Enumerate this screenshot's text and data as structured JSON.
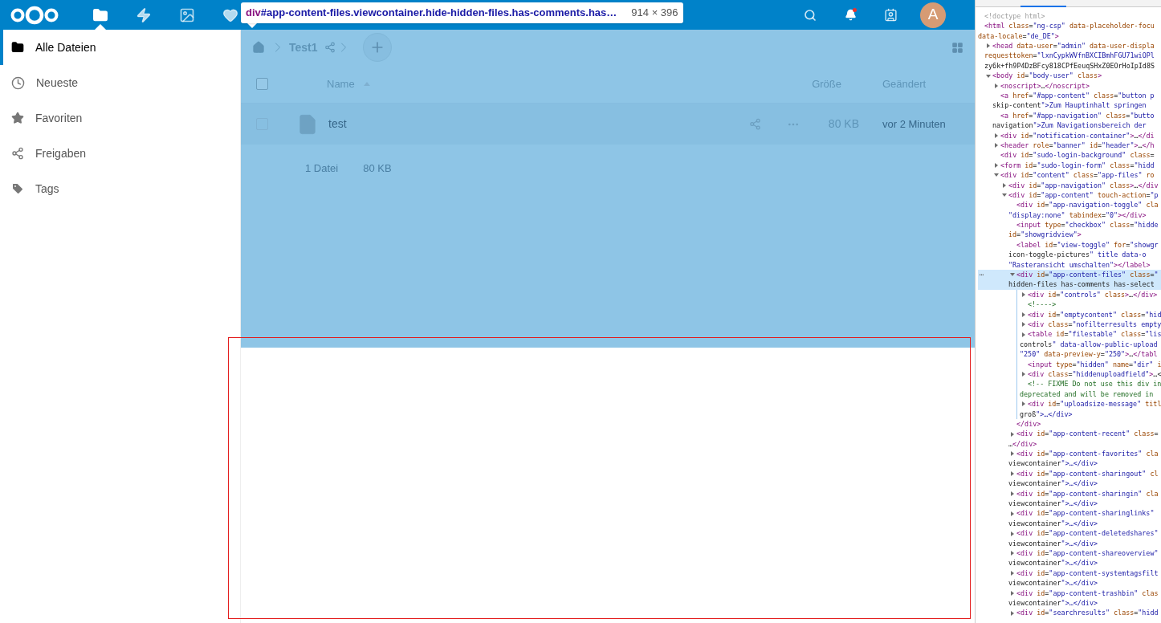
{
  "inspector_tooltip": {
    "tag": "div",
    "selector": "#app-content-files.viewcontainer.hide-hidden-files.has-comments.has…",
    "size": "914 × 396"
  },
  "header": {
    "apps": [
      {
        "kind": "files",
        "selected": true
      },
      {
        "kind": "activity",
        "selected": false
      },
      {
        "kind": "gallery",
        "selected": false
      },
      {
        "kind": "favorites",
        "selected": false
      }
    ],
    "actions": [
      {
        "kind": "search"
      },
      {
        "kind": "notifications",
        "unread": true
      },
      {
        "kind": "contacts"
      }
    ],
    "avatar": "A"
  },
  "sidebar": {
    "items": [
      {
        "label": "Alle Dateien",
        "kind": "folder",
        "selected": true
      },
      {
        "label": "Neueste",
        "kind": "clock",
        "selected": false
      },
      {
        "label": "Favoriten",
        "kind": "star",
        "selected": false
      },
      {
        "label": "Freigaben",
        "kind": "share",
        "selected": false
      },
      {
        "label": "Tags",
        "kind": "tag",
        "selected": false
      }
    ]
  },
  "files": {
    "highlighted": true,
    "breadcrumb": [
      "Test1"
    ],
    "columns": {
      "name": "Name",
      "size": "Größe",
      "modified": "Geändert"
    },
    "rows": [
      {
        "name": "test",
        "size": "80 KB",
        "modified": "vor 2 Minuten",
        "checked": false
      }
    ],
    "summary": {
      "count": "1 Datei",
      "size": "80 KB"
    }
  },
  "red_frame": true,
  "devtools": {
    "nodes": [
      {
        "kind": "doctype",
        "lines": [
          "<!doctype html>"
        ],
        "selected": false
      },
      {
        "kind": "element",
        "lines": [
          "<html class=\"ng-csp\" data-placeholder-focu",
          "data-locale=\"de_DE\">"
        ],
        "selected": false,
        "children": [
          {
            "kind": "element",
            "lines": [
              "<head data-user=\"admin\" data-user-displa",
              "requesttoken=\"lxnCypkWVfnBXCIBmhFGU71wiOPl",
              "zy6k+fh9P4DzBFcy818CPfEeuqSHxZ0EOrHoIpId8S"
            ],
            "expanded": false,
            "selected": false
          },
          {
            "kind": "element",
            "lines": [
              "<body id=\"body-user\" class>"
            ],
            "expanded": true,
            "selected": false,
            "children": [
              {
                "kind": "element",
                "lines": [
                  "<noscript>…</noscript>"
                ],
                "expanded": false,
                "selected": false
              },
              {
                "kind": "element",
                "lines": [
                  "<a href=\"#app-content\" class=\"button p",
                  "skip-content\">Zum Hauptinhalt springen"
                ],
                "selected": false
              },
              {
                "kind": "element",
                "lines": [
                  "<a href=\"#app-navigation\" class=\"butto",
                  "navigation\">Zum Navigationsbereich der"
                ],
                "selected": false
              },
              {
                "kind": "element",
                "lines": [
                  "<div id=\"notification-container\">…</di"
                ],
                "expanded": false,
                "selected": false
              },
              {
                "kind": "element",
                "lines": [
                  "<header role=\"banner\" id=\"header\">…</h"
                ],
                "expanded": false,
                "selected": false
              },
              {
                "kind": "element",
                "lines": [
                  "<div id=\"sudo-login-background\" class="
                ],
                "selected": false
              },
              {
                "kind": "element",
                "lines": [
                  "<form id=\"sudo-login-form\" class=\"hidd"
                ],
                "expanded": false,
                "selected": false
              },
              {
                "kind": "element",
                "lines": [
                  "<div id=\"content\" class=\"app-files\" ro"
                ],
                "expanded": true,
                "selected": false,
                "children": [
                  {
                    "kind": "element",
                    "lines": [
                      "<div id=\"app-navigation\" class>…</div"
                    ],
                    "expanded": false,
                    "selected": false
                  },
                  {
                    "kind": "element",
                    "lines": [
                      "<div id=\"app-content\" touch-action=\"p"
                    ],
                    "expanded": true,
                    "selected": false,
                    "children": [
                      {
                        "kind": "element",
                        "lines": [
                          "<div id=\"app-navigation-toggle\" cla",
                          "\"display:none\" tabindex=\"0\"></div>"
                        ],
                        "selected": false
                      },
                      {
                        "kind": "element",
                        "lines": [
                          "<input type=\"checkbox\" class=\"hidde",
                          "id=\"showgridview\">"
                        ],
                        "selected": false
                      },
                      {
                        "kind": "element",
                        "lines": [
                          "<label id=\"view-toggle\" for=\"showgr",
                          "icon-toggle-pictures\" title data-o",
                          "\"Rasteransicht umschalten\"></label>"
                        ],
                        "selected": false
                      },
                      {
                        "kind": "element",
                        "lines": [
                          "<div id=\"app-content-files\" class=\"",
                          "hidden-files has-comments has-select"
                        ],
                        "expanded": true,
                        "selected": true,
                        "marker": "⋯",
                        "close": "</div>",
                        "children": [
                          {
                            "kind": "element",
                            "lines": [
                              "<div id=\"controls\" class>…</div>"
                            ],
                            "expanded": false,
                            "selected": false
                          },
                          {
                            "kind": "comment",
                            "lines": [
                              "<!---->"
                            ],
                            "selected": false
                          },
                          {
                            "kind": "element",
                            "lines": [
                              "<div id=\"emptycontent\" class=\"hid"
                            ],
                            "expanded": false,
                            "selected": false
                          },
                          {
                            "kind": "element",
                            "lines": [
                              "<div class=\"nofilterresults empty"
                            ],
                            "expanded": false,
                            "selected": false
                          },
                          {
                            "kind": "element",
                            "lines": [
                              "<table id=\"filestable\" class=\"lis",
                              "controls\" data-allow-public-upload",
                              "\"250\" data-preview-y=\"250\">…</tabl"
                            ],
                            "expanded": false,
                            "selected": false
                          },
                          {
                            "kind": "element",
                            "lines": [
                              "<input type=\"hidden\" name=\"dir\" i"
                            ],
                            "selected": false
                          },
                          {
                            "kind": "element",
                            "lines": [
                              "<div class=\"hiddenuploadfield\">…<"
                            ],
                            "expanded": false,
                            "selected": false
                          },
                          {
                            "kind": "comment",
                            "lines": [
                              "<!-- FIXME Do not use this div in",
                              "deprecated and will be removed in"
                            ],
                            "selected": false
                          },
                          {
                            "kind": "element",
                            "lines": [
                              "<div id=\"uploadsize-message\" titl",
                              "groß\">…</div>"
                            ],
                            "expanded": false,
                            "selected": false
                          }
                        ]
                      },
                      {
                        "kind": "element",
                        "lines": [
                          "<div id=\"app-content-recent\" class=",
                          "…</div>"
                        ],
                        "expanded": false,
                        "selected": false
                      },
                      {
                        "kind": "element",
                        "lines": [
                          "<div id=\"app-content-favorites\" cla",
                          "viewcontainer\">…</div>"
                        ],
                        "expanded": false,
                        "selected": false
                      },
                      {
                        "kind": "element",
                        "lines": [
                          "<div id=\"app-content-sharingout\" cl",
                          "viewcontainer\">…</div>"
                        ],
                        "expanded": false,
                        "selected": false
                      },
                      {
                        "kind": "element",
                        "lines": [
                          "<div id=\"app-content-sharingin\" cla",
                          "viewcontainer\">…</div>"
                        ],
                        "expanded": false,
                        "selected": false
                      },
                      {
                        "kind": "element",
                        "lines": [
                          "<div id=\"app-content-sharinglinks\"",
                          "viewcontainer\">…</div>"
                        ],
                        "expanded": false,
                        "selected": false
                      },
                      {
                        "kind": "element",
                        "lines": [
                          "<div id=\"app-content-deletedshares\"",
                          "viewcontainer\">…</div>"
                        ],
                        "expanded": false,
                        "selected": false
                      },
                      {
                        "kind": "element",
                        "lines": [
                          "<div id=\"app-content-shareoverview\"",
                          "viewcontainer\">…</div>"
                        ],
                        "expanded": false,
                        "selected": false
                      },
                      {
                        "kind": "element",
                        "lines": [
                          "<div id=\"app-content-systemtagsfilt",
                          "viewcontainer\">…</div>"
                        ],
                        "expanded": false,
                        "selected": false
                      },
                      {
                        "kind": "element",
                        "lines": [
                          "<div id=\"app-content-trashbin\" clas",
                          "viewcontainer\">…</div>"
                        ],
                        "expanded": false,
                        "selected": false
                      },
                      {
                        "kind": "element",
                        "lines": [
                          "<div id=\"searchresults\" class=\"hidd"
                        ],
                        "expanded": false,
                        "selected": false
                      }
                    ]
                  }
                ]
              }
            ]
          }
        ]
      }
    ]
  }
}
